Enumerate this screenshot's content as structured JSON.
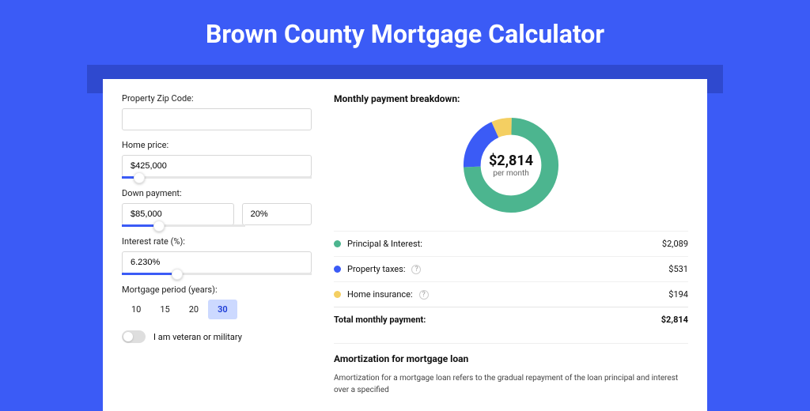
{
  "title": "Brown County Mortgage Calculator",
  "colors": {
    "green": "#4cb58f",
    "blue": "#3b5bf6",
    "yellow": "#f4cf62"
  },
  "form": {
    "zip": {
      "label": "Property Zip Code:",
      "value": ""
    },
    "home_price": {
      "label": "Home price:",
      "value": "$425,000",
      "slider_pct": 9
    },
    "down_payment": {
      "label": "Down payment:",
      "amount": "$85,000",
      "percent": "20%",
      "slider_pct": 20
    },
    "interest_rate": {
      "label": "Interest rate (%):",
      "value": "6.230%",
      "slider_pct": 29
    },
    "period": {
      "label": "Mortgage period (years):",
      "options": [
        "10",
        "15",
        "20",
        "30"
      ],
      "selected": "30"
    },
    "veteran": {
      "label": "I am veteran or military",
      "checked": false
    }
  },
  "breakdown": {
    "title": "Monthly payment breakdown:",
    "center_amount": "$2,814",
    "center_sub": "per month",
    "rows": [
      {
        "label": "Principal & Interest:",
        "value": "$2,089",
        "color": "#4cb58f",
        "info": false
      },
      {
        "label": "Property taxes:",
        "value": "$531",
        "color": "#3b5bf6",
        "info": true
      },
      {
        "label": "Home insurance:",
        "value": "$194",
        "color": "#f4cf62",
        "info": true
      }
    ],
    "total_label": "Total monthly payment:",
    "total_value": "$2,814"
  },
  "amortization": {
    "title": "Amortization for mortgage loan",
    "text": "Amortization for a mortgage loan refers to the gradual repayment of the loan principal and interest over a specified"
  },
  "chart_data": {
    "type": "pie",
    "title": "Monthly payment breakdown",
    "series": [
      {
        "name": "Principal & Interest",
        "value": 2089,
        "color": "#4cb58f"
      },
      {
        "name": "Property taxes",
        "value": 531,
        "color": "#3b5bf6"
      },
      {
        "name": "Home insurance",
        "value": 194,
        "color": "#f4cf62"
      }
    ],
    "total": 2814
  }
}
